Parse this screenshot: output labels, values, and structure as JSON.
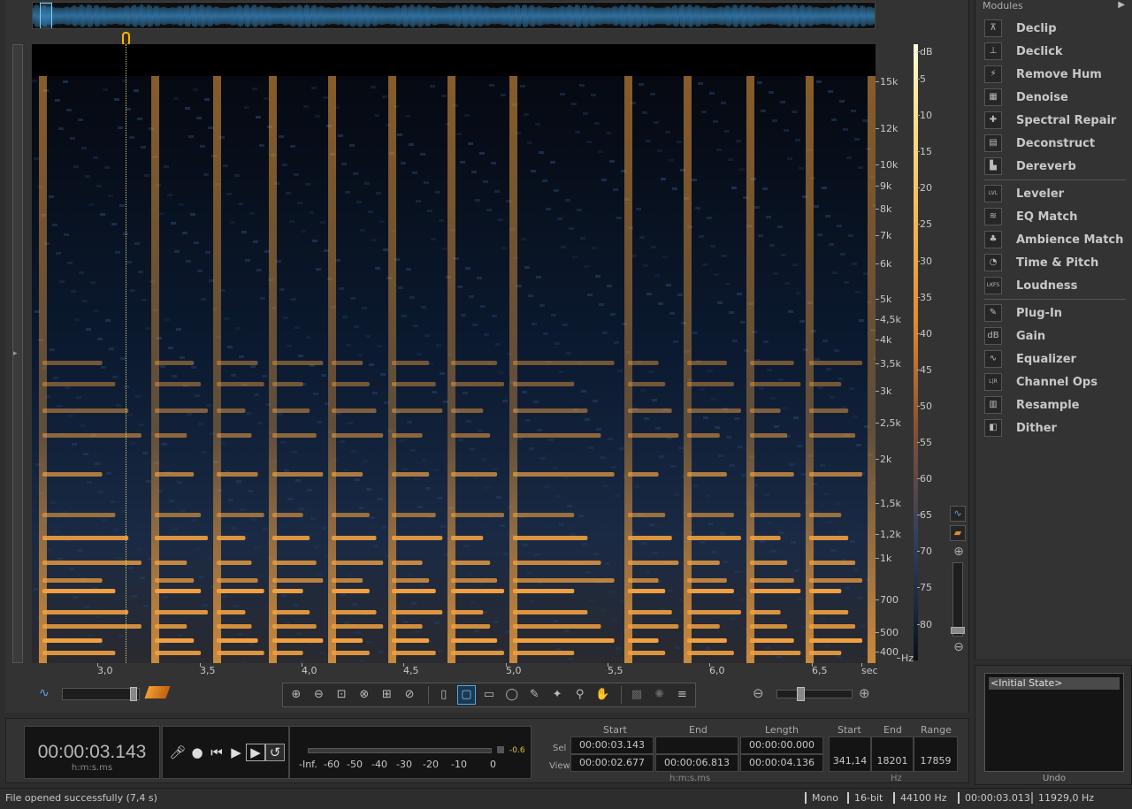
{
  "modules": {
    "header": "Modules",
    "items": [
      {
        "label": "Declip",
        "icon": "declip-icon"
      },
      {
        "label": "Declick",
        "icon": "declick-icon"
      },
      {
        "label": "Remove Hum",
        "icon": "hum-icon"
      },
      {
        "label": "Denoise",
        "icon": "denoise-icon"
      },
      {
        "label": "Spectral Repair",
        "icon": "spectral-repair-icon"
      },
      {
        "label": "Deconstruct",
        "icon": "deconstruct-icon"
      },
      {
        "label": "Dereverb",
        "icon": "dereverb-icon"
      },
      {
        "label": "Leveler",
        "icon": "leveler-icon"
      },
      {
        "label": "EQ Match",
        "icon": "eq-match-icon"
      },
      {
        "label": "Ambience Match",
        "icon": "ambience-icon"
      },
      {
        "label": "Time & Pitch",
        "icon": "time-pitch-icon"
      },
      {
        "label": "Loudness",
        "icon": "loudness-icon"
      },
      {
        "label": "Plug-In",
        "icon": "plugin-icon"
      },
      {
        "label": "Gain",
        "icon": "gain-icon"
      },
      {
        "label": "Equalizer",
        "icon": "equalizer-icon"
      },
      {
        "label": "Channel Ops",
        "icon": "channel-ops-icon"
      },
      {
        "label": "Resample",
        "icon": "resample-icon"
      },
      {
        "label": "Dither",
        "icon": "dither-icon"
      }
    ],
    "icon_glyphs": [
      "⊼",
      "⊥",
      "⚡",
      "▦",
      "✚",
      "▤",
      "▙",
      "LVL",
      "≋",
      "♣",
      "◔",
      "LKFS",
      "✎",
      "dB",
      "∿",
      "L|R",
      "▥",
      "◧"
    ]
  },
  "spectrogram": {
    "freq_labels": [
      "15k",
      "12k",
      "10k",
      "9k",
      "8k",
      "7k",
      "6k",
      "5k",
      "4,5k",
      "4k",
      "3,5k",
      "3k",
      "2,5k",
      "2k",
      "1,5k",
      "1,2k",
      "1k",
      "700",
      "500",
      "400",
      "Hz"
    ],
    "db_labels": [
      "dB",
      "5",
      "10",
      "15",
      "20",
      "25",
      "30",
      "35",
      "40",
      "45",
      "50",
      "55",
      "60",
      "65",
      "70",
      "75",
      "80"
    ],
    "time_labels": [
      "3,0",
      "3,5",
      "4,0",
      "4,5",
      "5,0",
      "5,5",
      "6,0",
      "6,5",
      "sec"
    ]
  },
  "transport": {
    "time": "00:00:03.143",
    "time_format": "h:m:s.ms",
    "meter_peak": "-0.6",
    "meter_labels": [
      "-Inf.",
      "-60",
      "-50",
      "-40",
      "-30",
      "-20",
      "-10",
      "0"
    ]
  },
  "selection": {
    "headers": {
      "start": "Start",
      "end": "End",
      "length": "Length"
    },
    "sel_label": "Sel",
    "view_label": "View",
    "sel": {
      "start": "00:00:03.143",
      "end": "",
      "length": "00:00:00.000"
    },
    "view": {
      "start": "00:00:02.677",
      "end": "00:00:06.813",
      "length": "00:00:04.136"
    },
    "format": "h:m:s.ms"
  },
  "frequency": {
    "headers": {
      "start": "Start",
      "end": "End",
      "range": "Range"
    },
    "start": "341,14",
    "end": "18201",
    "range": "17859",
    "unit": "Hz"
  },
  "undo": {
    "items": [
      "<Initial State>"
    ],
    "label": "Undo"
  },
  "status": {
    "message": "File opened successfully (7,4 s)",
    "channels": "Mono",
    "bit_depth": "16-bit",
    "sample_rate": "44100 Hz",
    "cursor_time": "00:00:03.013",
    "cursor_freq": "11929,0 Hz"
  },
  "colors": {
    "spectrogram_hot": "#f0a040",
    "spectrogram_cold": "#203a60",
    "accent": "#4fa8e8"
  }
}
